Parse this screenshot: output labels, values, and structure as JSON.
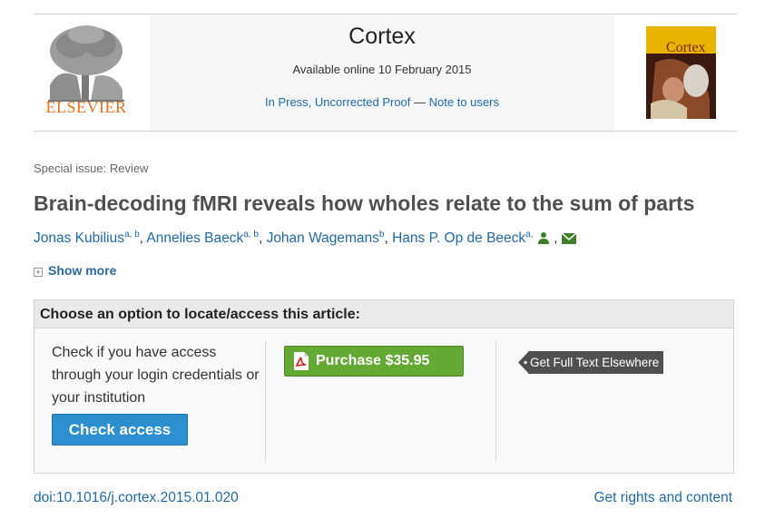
{
  "header": {
    "publisher": "ELSEVIER",
    "journal_title": "Cortex",
    "available_online": "Available online 10 February 2015",
    "in_press_label": "In Press, Uncorrected Proof",
    "dash": "—",
    "note_to_users": "Note to users",
    "cover_title": "Cortex"
  },
  "article": {
    "section": "Special issue: Review",
    "title": "Brain-decoding fMRI reveals how wholes relate to the sum of parts",
    "authors": [
      {
        "name": "Jonas Kubilius",
        "affil": "a, b"
      },
      {
        "name": "Annelies Baeck",
        "affil": "a, b"
      },
      {
        "name": "Johan Wagemans",
        "affil": "b"
      },
      {
        "name": "Hans P. Op de Beeck",
        "affil": "a,"
      }
    ],
    "show_more": "Show more",
    "plus": "+"
  },
  "access": {
    "heading": "Choose an option to locate/access this article:",
    "check_text": "Check if you have access through your login credentials or your institution",
    "check_button": "Check access",
    "purchase_button": "Purchase $35.95",
    "full_text": "Get Full Text Elsewhere"
  },
  "footer": {
    "doi": "doi:10.1016/j.cortex.2015.01.020",
    "rights": "Get rights and content"
  },
  "colors": {
    "link": "#1f69a6",
    "purchase": "#64a933",
    "check": "#2b8fd0",
    "elsevier_orange": "#e9711c"
  }
}
